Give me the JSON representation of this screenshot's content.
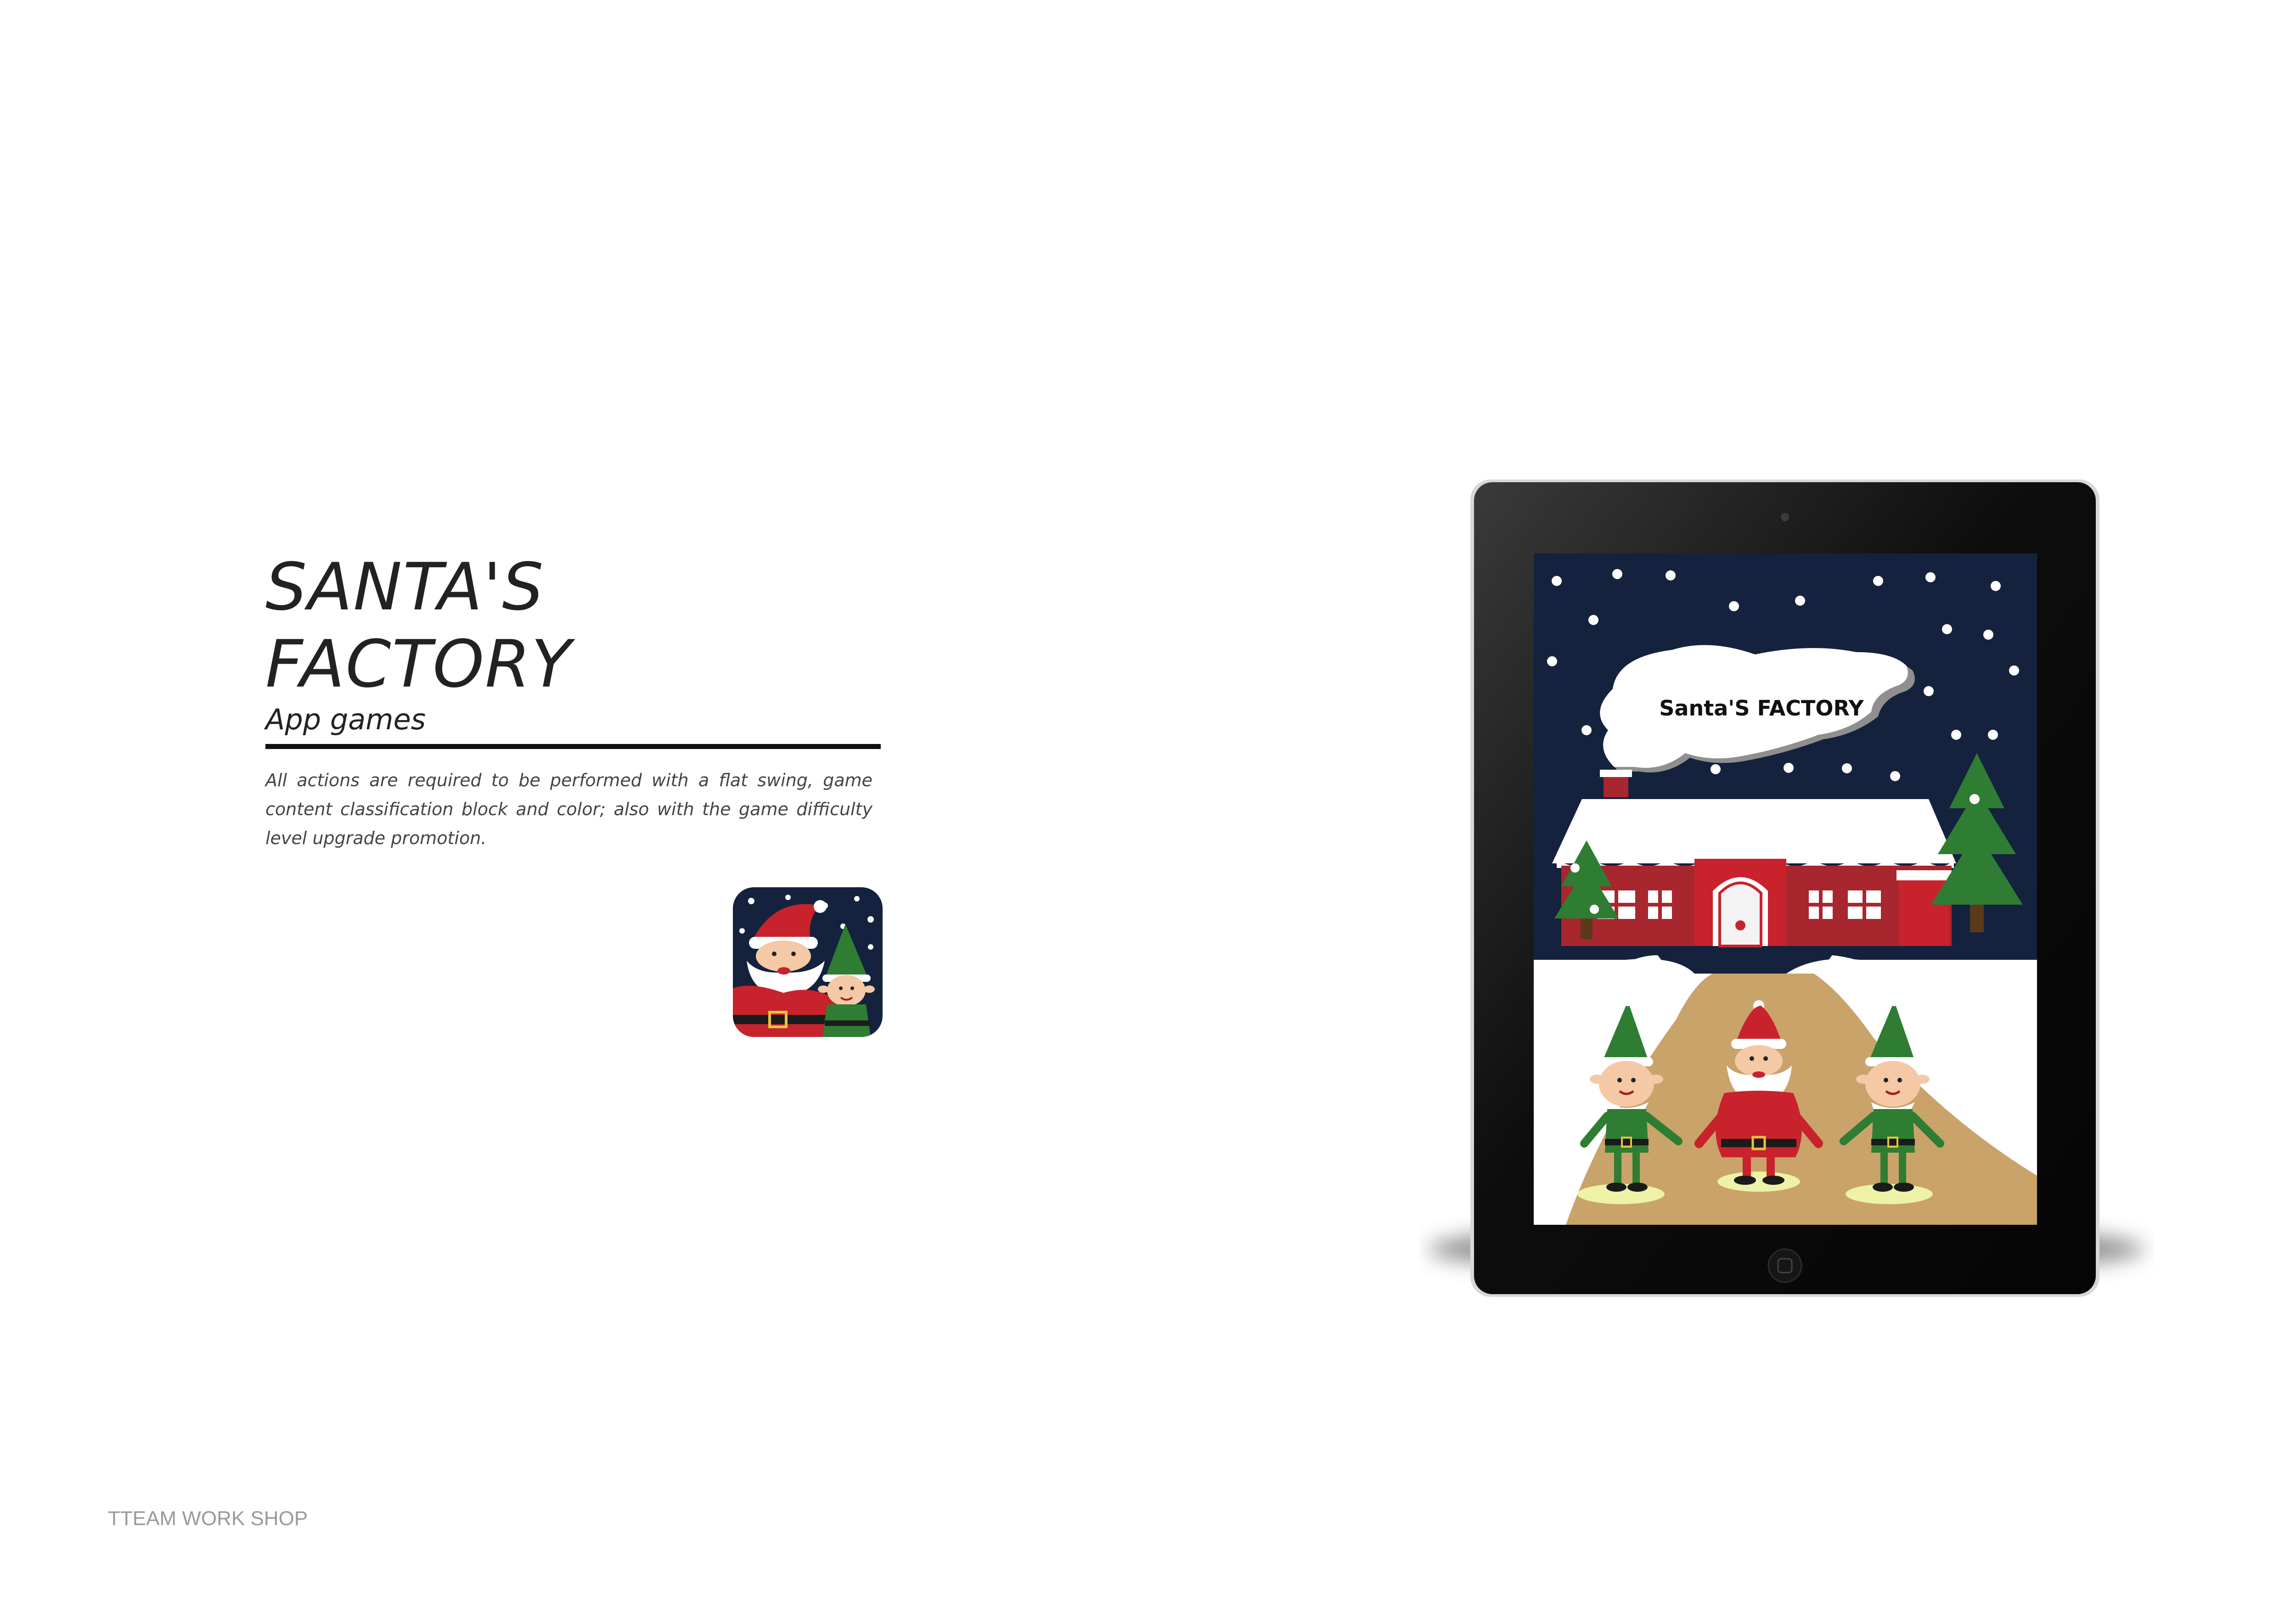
{
  "project": {
    "title_line_1": "SANTA'S",
    "title_line_2": "FACTORY",
    "category": "App games",
    "description": "All actions are required to be performed with a flat swing, game content classification block and color; also with the game difficulty level upgrade promotion."
  },
  "game_screen": {
    "logo_text": "Santa'S  FACTORY"
  },
  "footer": {
    "studio": "TTEAM WORK SHOP"
  },
  "colors": {
    "night_sky": "#14223d",
    "santa_red": "#c8222c",
    "elf_green": "#2e7d32",
    "house_red": "#a8262e",
    "path_tan": "#c9a36a",
    "snow": "#ffffff",
    "tablet_body": "#0b0b0b"
  }
}
